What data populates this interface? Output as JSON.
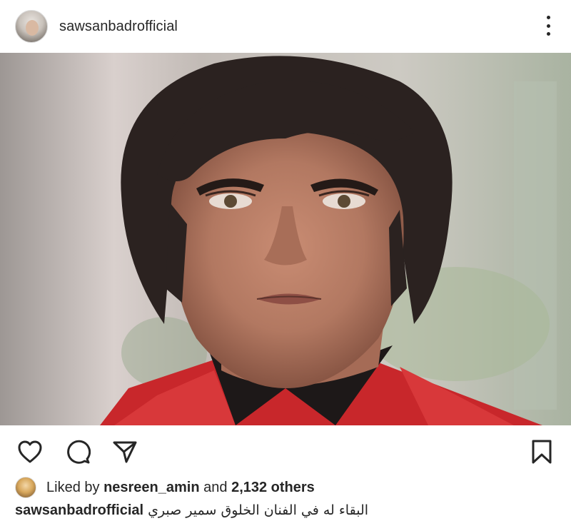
{
  "post": {
    "username": "sawsanbadrofficial",
    "photo_alt": ""
  },
  "likes": {
    "prefix": "Liked by",
    "user": "nesreen_amin",
    "connector": "and",
    "others": "2,132 others"
  },
  "caption": {
    "username": "sawsanbadrofficial",
    "text": "البقاء له في الفنان الخلوق سمير صبري"
  },
  "icons": {
    "more": "more-vertical-icon",
    "like": "heart-icon",
    "comment": "comment-icon",
    "share": "send-icon",
    "save": "bookmark-icon"
  },
  "colors": {
    "text": "#262626",
    "background": "#ffffff"
  }
}
